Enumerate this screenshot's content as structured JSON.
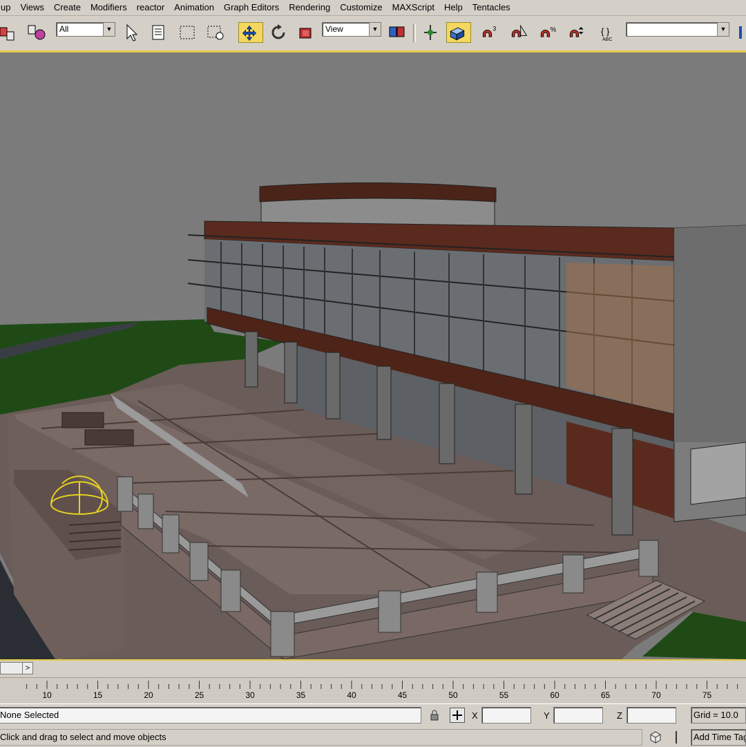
{
  "menu": [
    "up",
    "Views",
    "Create",
    "Modifiers",
    "reactor",
    "Animation",
    "Graph Editors",
    "Rendering",
    "Customize",
    "MAXScript",
    "Help",
    "Tentacles"
  ],
  "toolbar": {
    "selection_filter": "All",
    "reference_coord": "View",
    "named_selection": ""
  },
  "timeline": {
    "slider_label": ">",
    "ticks": [
      "10",
      "15",
      "20",
      "25",
      "30",
      "35",
      "40",
      "45",
      "50",
      "55",
      "60",
      "65",
      "70",
      "75"
    ]
  },
  "status": {
    "selection_text": "None Selected",
    "prompt_text": "Click and drag to select and move objects",
    "x_label": "X",
    "y_label": "Y",
    "z_label": "Z",
    "x_value": "",
    "y_value": "",
    "z_value": "",
    "grid_text": "Grid = 10.0",
    "add_time_tag": "Add Time Tag"
  },
  "icons": {
    "select": "cursor-arrow-icon",
    "move": "move-arrows-icon",
    "rotate": "rotate-icon",
    "snap": "magnet-icon"
  },
  "colors": {
    "accent": "#e3c94a",
    "ui": "#d4d0c8",
    "viewport_bg": "#7b7b7b"
  }
}
